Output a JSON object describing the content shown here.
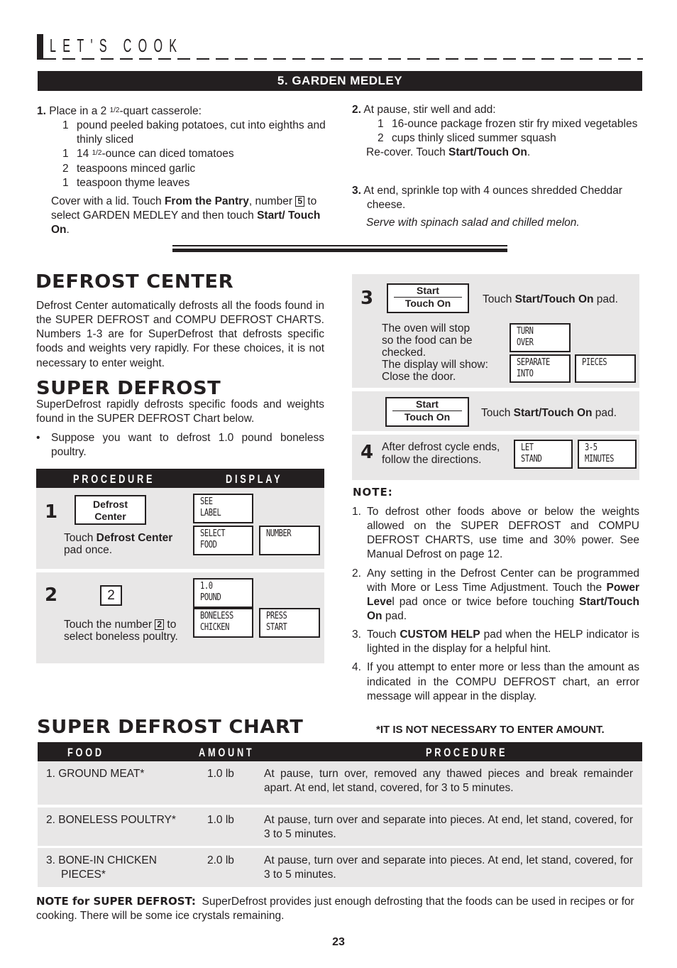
{
  "header": {
    "section_title": "LET'S COOK"
  },
  "recipe": {
    "title": "5. GARDEN MEDLEY",
    "step1": {
      "num": "1.",
      "intro_a": "Place in a 2 ",
      "intro_frac": "1/2",
      "intro_b": "-quart casserole:",
      "ingredients": [
        {
          "qty": "1",
          "text": "pound peeled baking potatoes, cut into eighths and thinly sliced"
        },
        {
          "qty": "1",
          "text_a": "14 ",
          "frac": "1/2",
          "text_b": "-ounce can diced tomatoes"
        },
        {
          "qty": "2",
          "text": "teaspoons minced garlic"
        },
        {
          "qty": "1",
          "text": "teaspoon thyme leaves"
        }
      ],
      "instr_a": "Cover with a lid. Touch ",
      "instr_bold1": "From the Pantry",
      "instr_b": ", number ",
      "instr_num": "5",
      "instr_c": " to select GARDEN MEDLEY and then touch ",
      "instr_bold2": "Start/ Touch On",
      "instr_d": "."
    },
    "step2": {
      "num": "2.",
      "intro": "At pause, stir well and add:",
      "ingredients": [
        {
          "qty": "1",
          "text": "16-ounce package frozen stir fry mixed vegetables"
        },
        {
          "qty": "2",
          "text": "cups thinly sliced summer squash"
        }
      ],
      "instr_a": "Re-cover. Touch ",
      "instr_bold": "Start/Touch On",
      "instr_b": "."
    },
    "step3": {
      "num": "3.",
      "text": "At end, sprinkle top with 4 ounces shredded Cheddar cheese.",
      "serve": "Serve with spinach salad and chilled melon."
    }
  },
  "defrost_center": {
    "title": "DEFROST CENTER",
    "body": "Defrost Center automatically defrosts all the foods found in the SUPER DEFROST and COMPU DEFROST CHARTS. Numbers 1-3 are for SuperDefrost that defrosts specific foods and weights very rapidly. For these choices, it is not necessary to enter weight."
  },
  "super_defrost": {
    "title": "SUPER DEFROST",
    "body": "SuperDefrost rapidly defrosts specific foods and weights found in the SUPER DEFROST Chart below.",
    "bullet": "Suppose you want to defrost 1.0 pound boneless poultry."
  },
  "procedure": {
    "col_procedure": "PROCEDURE",
    "col_display": "DISPLAY",
    "step1": {
      "num": "1",
      "key_line1": "Defrost",
      "key_line2": "Center",
      "text_a": "Touch ",
      "text_bold": "Defrost Center",
      "text_b": " pad once.",
      "displays": [
        [
          "SEE",
          "LABEL"
        ],
        [
          "SELECT",
          "FOOD"
        ],
        [
          "NUMBER",
          ""
        ]
      ]
    },
    "step2": {
      "num": "2",
      "key": "2",
      "text_a": "Touch the number ",
      "text_num": "2",
      "text_b": " to select boneless poultry.",
      "displays": [
        [
          "1.0",
          "POUND"
        ],
        [
          "BONELESS",
          "CHICKEN"
        ],
        [
          "PRESS",
          "START"
        ]
      ]
    },
    "step3": {
      "num": "3",
      "key_top": "Start",
      "key_bottom": "Touch On",
      "touch_a": "Touch ",
      "touch_bold": "Start/Touch On",
      "touch_b": " pad.",
      "desc": [
        "The oven will stop",
        "so the food can be",
        "checked.",
        "The display will show:",
        "Close the door."
      ],
      "displays": [
        [
          "TURN",
          "OVER"
        ],
        [
          "SEPARATE",
          "INTO"
        ],
        [
          "PIECES",
          ""
        ]
      ]
    },
    "step3b": {
      "key_top": "Start",
      "key_bottom": "Touch On",
      "touch_a": "Touch ",
      "touch_bold": "Start/Touch On",
      "touch_b": " pad."
    },
    "step4": {
      "num": "4",
      "text": [
        "After defrost cycle ends,",
        "follow the directions."
      ],
      "displays": [
        [
          "LET",
          "STAND"
        ],
        [
          "3-5",
          "MINUTES"
        ]
      ]
    }
  },
  "notes": {
    "title": "NOTE:",
    "items": [
      {
        "n": "1.",
        "text": "To defrost other foods above or below the weights allowed on the SUPER DEFROST and COMPU DEFROST CHARTS, use time and 30% power. See Manual Defrost on page 12."
      },
      {
        "n": "2.",
        "text_a": "Any setting in the Defrost Center can be programmed with More or Less Time Adjustment. Touch the ",
        "bold1": "Power Leve",
        "text_b": "l pad once or twice before touching ",
        "bold2": "Start/Touch On",
        "text_c": " pad."
      },
      {
        "n": "3.",
        "text_a": "Touch ",
        "bold1": "CUSTOM HELP",
        "text_b": " pad when the HELP indicator is lighted in the display for a helpful hint."
      },
      {
        "n": "4.",
        "text": "If you attempt to enter more or less than the amount as indicated in the COMPU DEFROST chart, an error message will appear in the display."
      }
    ]
  },
  "chart": {
    "title": "SUPER DEFROST CHART",
    "footnote": "*IT IS NOT NECESSARY TO ENTER AMOUNT.",
    "columns": [
      "FOOD",
      "AMOUNT",
      "PROCEDURE"
    ],
    "rows": [
      {
        "food": "1. GROUND MEAT*",
        "amount": "1.0 lb",
        "procedure": "At pause, turn over, removed any thawed pieces and break remainder apart. At end, let stand, covered, for 3 to 5 minutes."
      },
      {
        "food": "2. BONELESS POULTRY*",
        "amount": "1.0 lb",
        "procedure": "At pause, turn over and separate into pieces. At end, let stand, covered, for 3 to 5 minutes."
      },
      {
        "food": "3. BONE-IN CHICKEN PIECES*",
        "amount": "2.0 lb",
        "procedure": "At pause, turn over and separate into pieces. At end, let stand, covered, for 3 to 5 minutes."
      }
    ]
  },
  "footer": {
    "note_label": "NOTE for SUPER DEFROST:",
    "note_text": "SuperDefrost provides just enough defrosting that the foods can be used in recipes or for cooking. There will be some ice crystals remaining.",
    "page_number": "23"
  }
}
